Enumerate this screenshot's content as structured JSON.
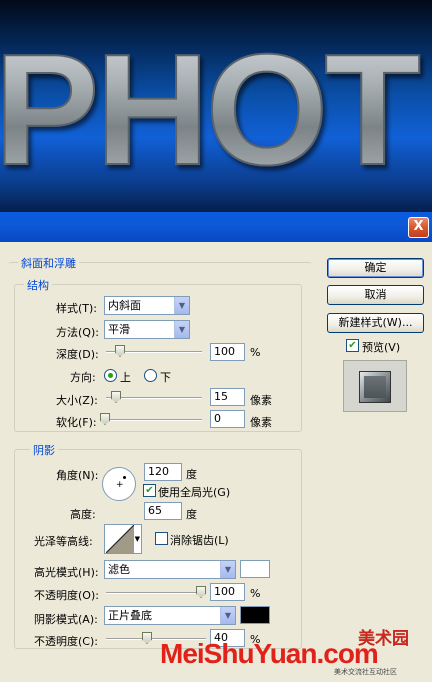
{
  "banner": {
    "text": "PHOT"
  },
  "dialog": {
    "close_glyph": "X",
    "bevel_group": {
      "title": "斜面和浮雕",
      "structure_title": "结构",
      "style_label": "样式(T):",
      "style_value": "内斜面",
      "technique_label": "方法(Q):",
      "technique_value": "平滑",
      "depth_label": "深度(D):",
      "depth_value": "100",
      "depth_unit": "%",
      "depth_level": 0.1,
      "direction_label": "方向:",
      "direction_up": "上",
      "direction_down": "下",
      "size_label": "大小(Z):",
      "size_value": "15",
      "size_unit": "像素",
      "size_level": 0.06,
      "soften_label": "软化(F):",
      "soften_value": "0",
      "soften_unit": "像素",
      "soften_level": 0
    },
    "shading_group": {
      "title": "阴影",
      "angle_label": "角度(N):",
      "angle_value": "120",
      "angle_unit": "度",
      "global_light_label": "使用全局光(G)",
      "altitude_label": "高度:",
      "altitude_value": "65",
      "altitude_unit": "度",
      "gloss_contour_label": "光泽等高线:",
      "anti_aliased_label": "消除锯齿(L)",
      "highlight_mode_label": "高光模式(H):",
      "highlight_mode_value": "滤色",
      "highlight_color": "#ffffff",
      "highlight_opacity_label": "不透明度(O):",
      "highlight_opacity_value": "100",
      "highlight_opacity_unit": "%",
      "highlight_opacity_level": 1.0,
      "shadow_mode_label": "阴影模式(A):",
      "shadow_mode_value": "正片叠底",
      "shadow_color": "#000000",
      "shadow_opacity_label": "不透明度(C):",
      "shadow_opacity_value": "40",
      "shadow_opacity_unit": "%",
      "shadow_opacity_level": 0.4
    },
    "buttons": {
      "ok": "确定",
      "cancel": "取消",
      "new_style": "新建样式(W)...",
      "preview_label": "预览(V)"
    }
  },
  "watermark": {
    "cn": "美术园",
    "en": "MeiShuYuan.com",
    "sub": "美术交流社互动社区"
  },
  "icons": [
    "close-icon",
    "dropdown-arrow-icon",
    "check-icon",
    "radio-icon",
    "slider-thumb-icon",
    "angle-dial-icon",
    "contour-icon",
    "preview-swatch-icon"
  ]
}
